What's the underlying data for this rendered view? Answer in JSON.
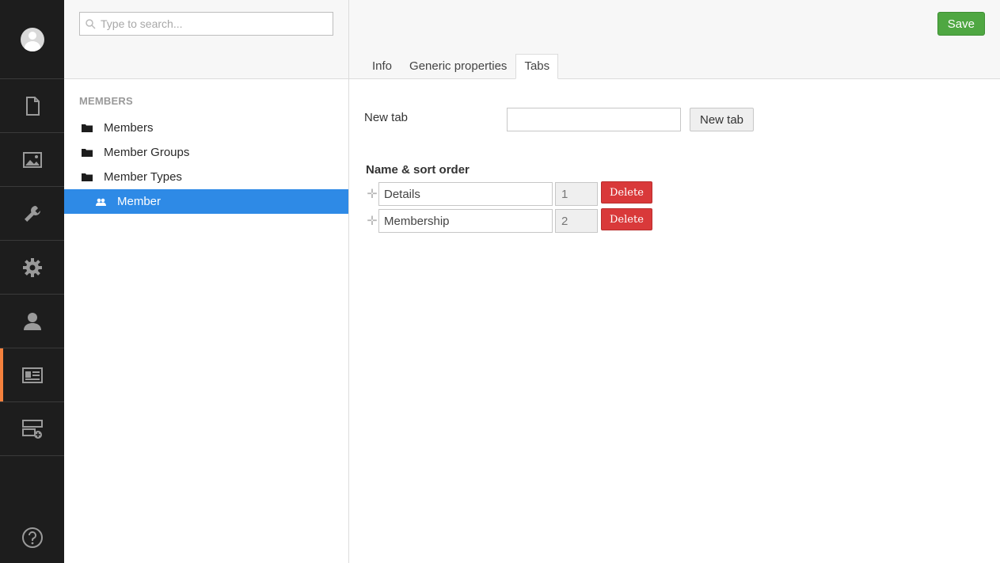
{
  "rail": {
    "items": [
      {
        "icon": "content-icon"
      },
      {
        "icon": "media-icon"
      },
      {
        "icon": "developer-icon"
      },
      {
        "icon": "settings-icon"
      },
      {
        "icon": "users-icon"
      },
      {
        "icon": "members-icon",
        "active": true
      },
      {
        "icon": "forms-icon"
      }
    ],
    "accent_color": "#f5813d"
  },
  "tree": {
    "search_placeholder": "Type to search...",
    "section_title": "MEMBERS",
    "nodes": [
      {
        "label": "Members"
      },
      {
        "label": "Member Groups"
      },
      {
        "label": "Member Types"
      },
      {
        "label": "Member",
        "selected": true
      }
    ],
    "selected_color": "#2e8ae6"
  },
  "header": {
    "save_label": "Save",
    "tabs": [
      {
        "label": "Info"
      },
      {
        "label": "Generic properties"
      },
      {
        "label": "Tabs",
        "active": true
      }
    ]
  },
  "tabs_editor": {
    "new_tab_label": "New tab",
    "new_tab_value": "",
    "new_tab_button": "New tab",
    "sort_title": "Name & sort order",
    "rows": [
      {
        "name": "Details",
        "order": "1",
        "delete_label": "Delete"
      },
      {
        "name": "Membership",
        "order": "2",
        "delete_label": "Delete"
      }
    ]
  },
  "colors": {
    "save": "#4fa742",
    "delete": "#d9393a",
    "rail_bg": "#1d1d1d"
  }
}
